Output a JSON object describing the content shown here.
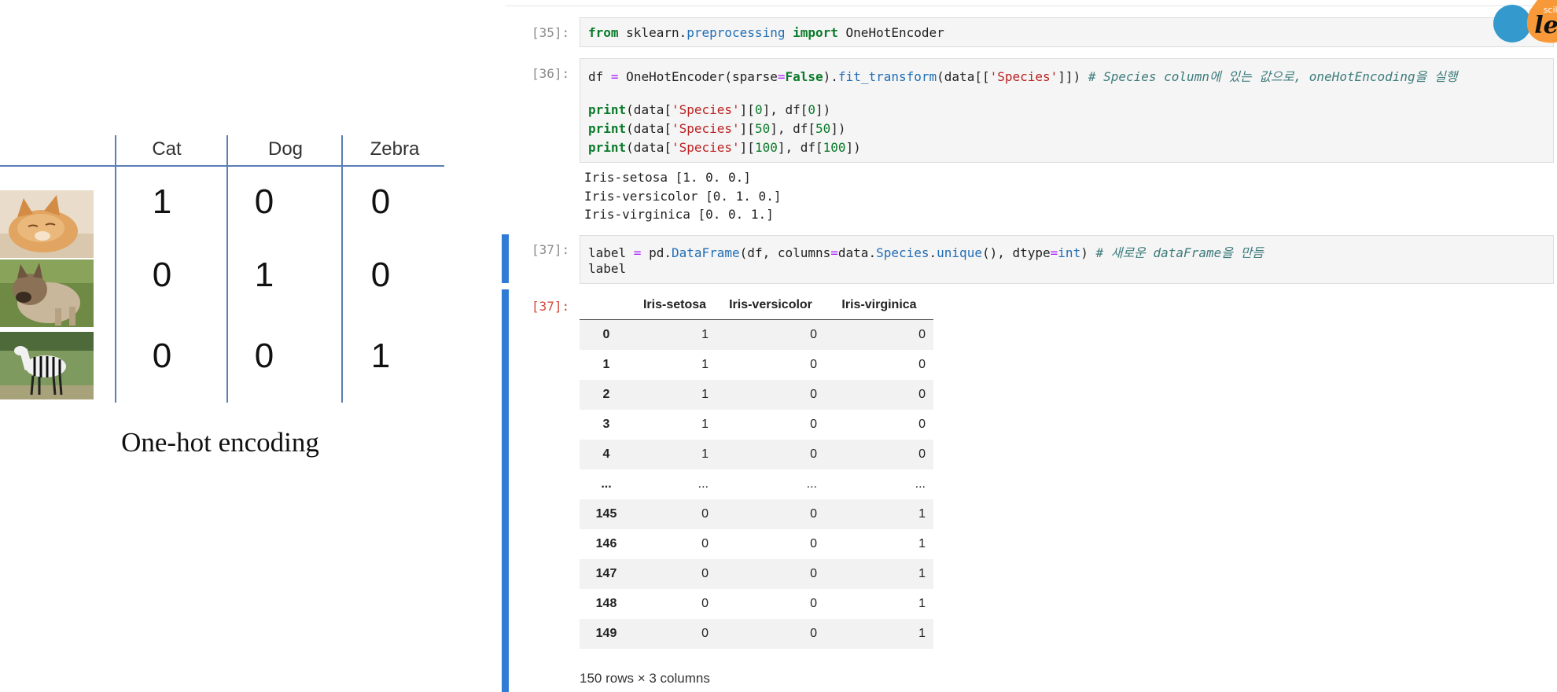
{
  "illustration": {
    "columns": [
      "Cat",
      "Dog",
      "Zebra"
    ],
    "rows": [
      {
        "image": "cat-photo",
        "values": [
          "1",
          "0",
          "0"
        ]
      },
      {
        "image": "dog-photo",
        "values": [
          "0",
          "1",
          "0"
        ]
      },
      {
        "image": "zebra-photo",
        "values": [
          "0",
          "0",
          "1"
        ]
      }
    ],
    "caption": "One-hot encoding"
  },
  "logo": {
    "small_text": "scikit",
    "text": "learn"
  },
  "cells": {
    "c35": {
      "prompt": "[35]:"
    },
    "c36": {
      "prompt": "[36]:",
      "output": [
        "Iris-setosa [1. 0. 0.]",
        "Iris-versicolor [0. 1. 0.]",
        "Iris-virginica [0. 0. 1.]"
      ]
    },
    "c37": {
      "prompt": "[37]:"
    },
    "c37out": {
      "prompt": "[37]:"
    }
  },
  "dataframe": {
    "columns": [
      "Iris-setosa",
      "Iris-versicolor",
      "Iris-virginica"
    ],
    "rows": [
      {
        "index": "0",
        "values": [
          "1",
          "0",
          "0"
        ]
      },
      {
        "index": "1",
        "values": [
          "1",
          "0",
          "0"
        ]
      },
      {
        "index": "2",
        "values": [
          "1",
          "0",
          "0"
        ]
      },
      {
        "index": "3",
        "values": [
          "1",
          "0",
          "0"
        ]
      },
      {
        "index": "4",
        "values": [
          "1",
          "0",
          "0"
        ]
      },
      {
        "index": "...",
        "values": [
          "...",
          "...",
          "..."
        ]
      },
      {
        "index": "145",
        "values": [
          "0",
          "0",
          "1"
        ]
      },
      {
        "index": "146",
        "values": [
          "0",
          "0",
          "1"
        ]
      },
      {
        "index": "147",
        "values": [
          "0",
          "0",
          "1"
        ]
      },
      {
        "index": "148",
        "values": [
          "0",
          "0",
          "1"
        ]
      },
      {
        "index": "149",
        "values": [
          "0",
          "0",
          "1"
        ]
      }
    ],
    "shape": "150 rows × 3 columns"
  },
  "colors": {
    "active_bar": "#2f7bd6",
    "logo_blue": "#3499cd",
    "logo_orange": "#f89939"
  }
}
